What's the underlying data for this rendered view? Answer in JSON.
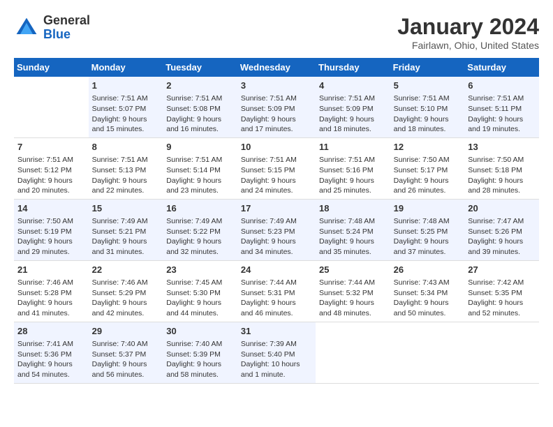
{
  "header": {
    "logo_general": "General",
    "logo_blue": "Blue",
    "title": "January 2024",
    "location": "Fairlawn, Ohio, United States"
  },
  "calendar": {
    "days_of_week": [
      "Sunday",
      "Monday",
      "Tuesday",
      "Wednesday",
      "Thursday",
      "Friday",
      "Saturday"
    ],
    "weeks": [
      [
        {
          "day": "",
          "info": ""
        },
        {
          "day": "1",
          "info": "Sunrise: 7:51 AM\nSunset: 5:07 PM\nDaylight: 9 hours\nand 15 minutes."
        },
        {
          "day": "2",
          "info": "Sunrise: 7:51 AM\nSunset: 5:08 PM\nDaylight: 9 hours\nand 16 minutes."
        },
        {
          "day": "3",
          "info": "Sunrise: 7:51 AM\nSunset: 5:09 PM\nDaylight: 9 hours\nand 17 minutes."
        },
        {
          "day": "4",
          "info": "Sunrise: 7:51 AM\nSunset: 5:09 PM\nDaylight: 9 hours\nand 18 minutes."
        },
        {
          "day": "5",
          "info": "Sunrise: 7:51 AM\nSunset: 5:10 PM\nDaylight: 9 hours\nand 18 minutes."
        },
        {
          "day": "6",
          "info": "Sunrise: 7:51 AM\nSunset: 5:11 PM\nDaylight: 9 hours\nand 19 minutes."
        }
      ],
      [
        {
          "day": "7",
          "info": "Sunrise: 7:51 AM\nSunset: 5:12 PM\nDaylight: 9 hours\nand 20 minutes."
        },
        {
          "day": "8",
          "info": "Sunrise: 7:51 AM\nSunset: 5:13 PM\nDaylight: 9 hours\nand 22 minutes."
        },
        {
          "day": "9",
          "info": "Sunrise: 7:51 AM\nSunset: 5:14 PM\nDaylight: 9 hours\nand 23 minutes."
        },
        {
          "day": "10",
          "info": "Sunrise: 7:51 AM\nSunset: 5:15 PM\nDaylight: 9 hours\nand 24 minutes."
        },
        {
          "day": "11",
          "info": "Sunrise: 7:51 AM\nSunset: 5:16 PM\nDaylight: 9 hours\nand 25 minutes."
        },
        {
          "day": "12",
          "info": "Sunrise: 7:50 AM\nSunset: 5:17 PM\nDaylight: 9 hours\nand 26 minutes."
        },
        {
          "day": "13",
          "info": "Sunrise: 7:50 AM\nSunset: 5:18 PM\nDaylight: 9 hours\nand 28 minutes."
        }
      ],
      [
        {
          "day": "14",
          "info": "Sunrise: 7:50 AM\nSunset: 5:19 PM\nDaylight: 9 hours\nand 29 minutes."
        },
        {
          "day": "15",
          "info": "Sunrise: 7:49 AM\nSunset: 5:21 PM\nDaylight: 9 hours\nand 31 minutes."
        },
        {
          "day": "16",
          "info": "Sunrise: 7:49 AM\nSunset: 5:22 PM\nDaylight: 9 hours\nand 32 minutes."
        },
        {
          "day": "17",
          "info": "Sunrise: 7:49 AM\nSunset: 5:23 PM\nDaylight: 9 hours\nand 34 minutes."
        },
        {
          "day": "18",
          "info": "Sunrise: 7:48 AM\nSunset: 5:24 PM\nDaylight: 9 hours\nand 35 minutes."
        },
        {
          "day": "19",
          "info": "Sunrise: 7:48 AM\nSunset: 5:25 PM\nDaylight: 9 hours\nand 37 minutes."
        },
        {
          "day": "20",
          "info": "Sunrise: 7:47 AM\nSunset: 5:26 PM\nDaylight: 9 hours\nand 39 minutes."
        }
      ],
      [
        {
          "day": "21",
          "info": "Sunrise: 7:46 AM\nSunset: 5:28 PM\nDaylight: 9 hours\nand 41 minutes."
        },
        {
          "day": "22",
          "info": "Sunrise: 7:46 AM\nSunset: 5:29 PM\nDaylight: 9 hours\nand 42 minutes."
        },
        {
          "day": "23",
          "info": "Sunrise: 7:45 AM\nSunset: 5:30 PM\nDaylight: 9 hours\nand 44 minutes."
        },
        {
          "day": "24",
          "info": "Sunrise: 7:44 AM\nSunset: 5:31 PM\nDaylight: 9 hours\nand 46 minutes."
        },
        {
          "day": "25",
          "info": "Sunrise: 7:44 AM\nSunset: 5:32 PM\nDaylight: 9 hours\nand 48 minutes."
        },
        {
          "day": "26",
          "info": "Sunrise: 7:43 AM\nSunset: 5:34 PM\nDaylight: 9 hours\nand 50 minutes."
        },
        {
          "day": "27",
          "info": "Sunrise: 7:42 AM\nSunset: 5:35 PM\nDaylight: 9 hours\nand 52 minutes."
        }
      ],
      [
        {
          "day": "28",
          "info": "Sunrise: 7:41 AM\nSunset: 5:36 PM\nDaylight: 9 hours\nand 54 minutes."
        },
        {
          "day": "29",
          "info": "Sunrise: 7:40 AM\nSunset: 5:37 PM\nDaylight: 9 hours\nand 56 minutes."
        },
        {
          "day": "30",
          "info": "Sunrise: 7:40 AM\nSunset: 5:39 PM\nDaylight: 9 hours\nand 58 minutes."
        },
        {
          "day": "31",
          "info": "Sunrise: 7:39 AM\nSunset: 5:40 PM\nDaylight: 10 hours\nand 1 minute."
        },
        {
          "day": "",
          "info": ""
        },
        {
          "day": "",
          "info": ""
        },
        {
          "day": "",
          "info": ""
        }
      ]
    ]
  }
}
